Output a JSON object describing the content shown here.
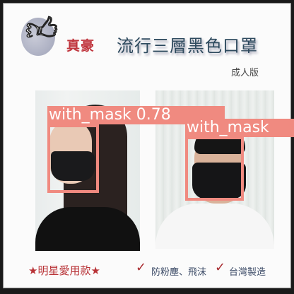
{
  "ad": {
    "brand": "真豪",
    "title": "流行三層黑色口罩",
    "subtitle": "成人版",
    "footer_left": "★明星愛用款★",
    "footer_feature_1": "防粉塵、飛沫",
    "footer_feature_2": "台灣製造",
    "check_glyph": "✓"
  },
  "detections": [
    {
      "label": "with_mask 0.78",
      "class": "with_mask",
      "score": 0.78
    },
    {
      "label": "with_mask",
      "class": "with_mask"
    }
  ],
  "colors": {
    "box": "#f08a80",
    "brand": "#c0353d",
    "title": "#2e4a5e"
  }
}
